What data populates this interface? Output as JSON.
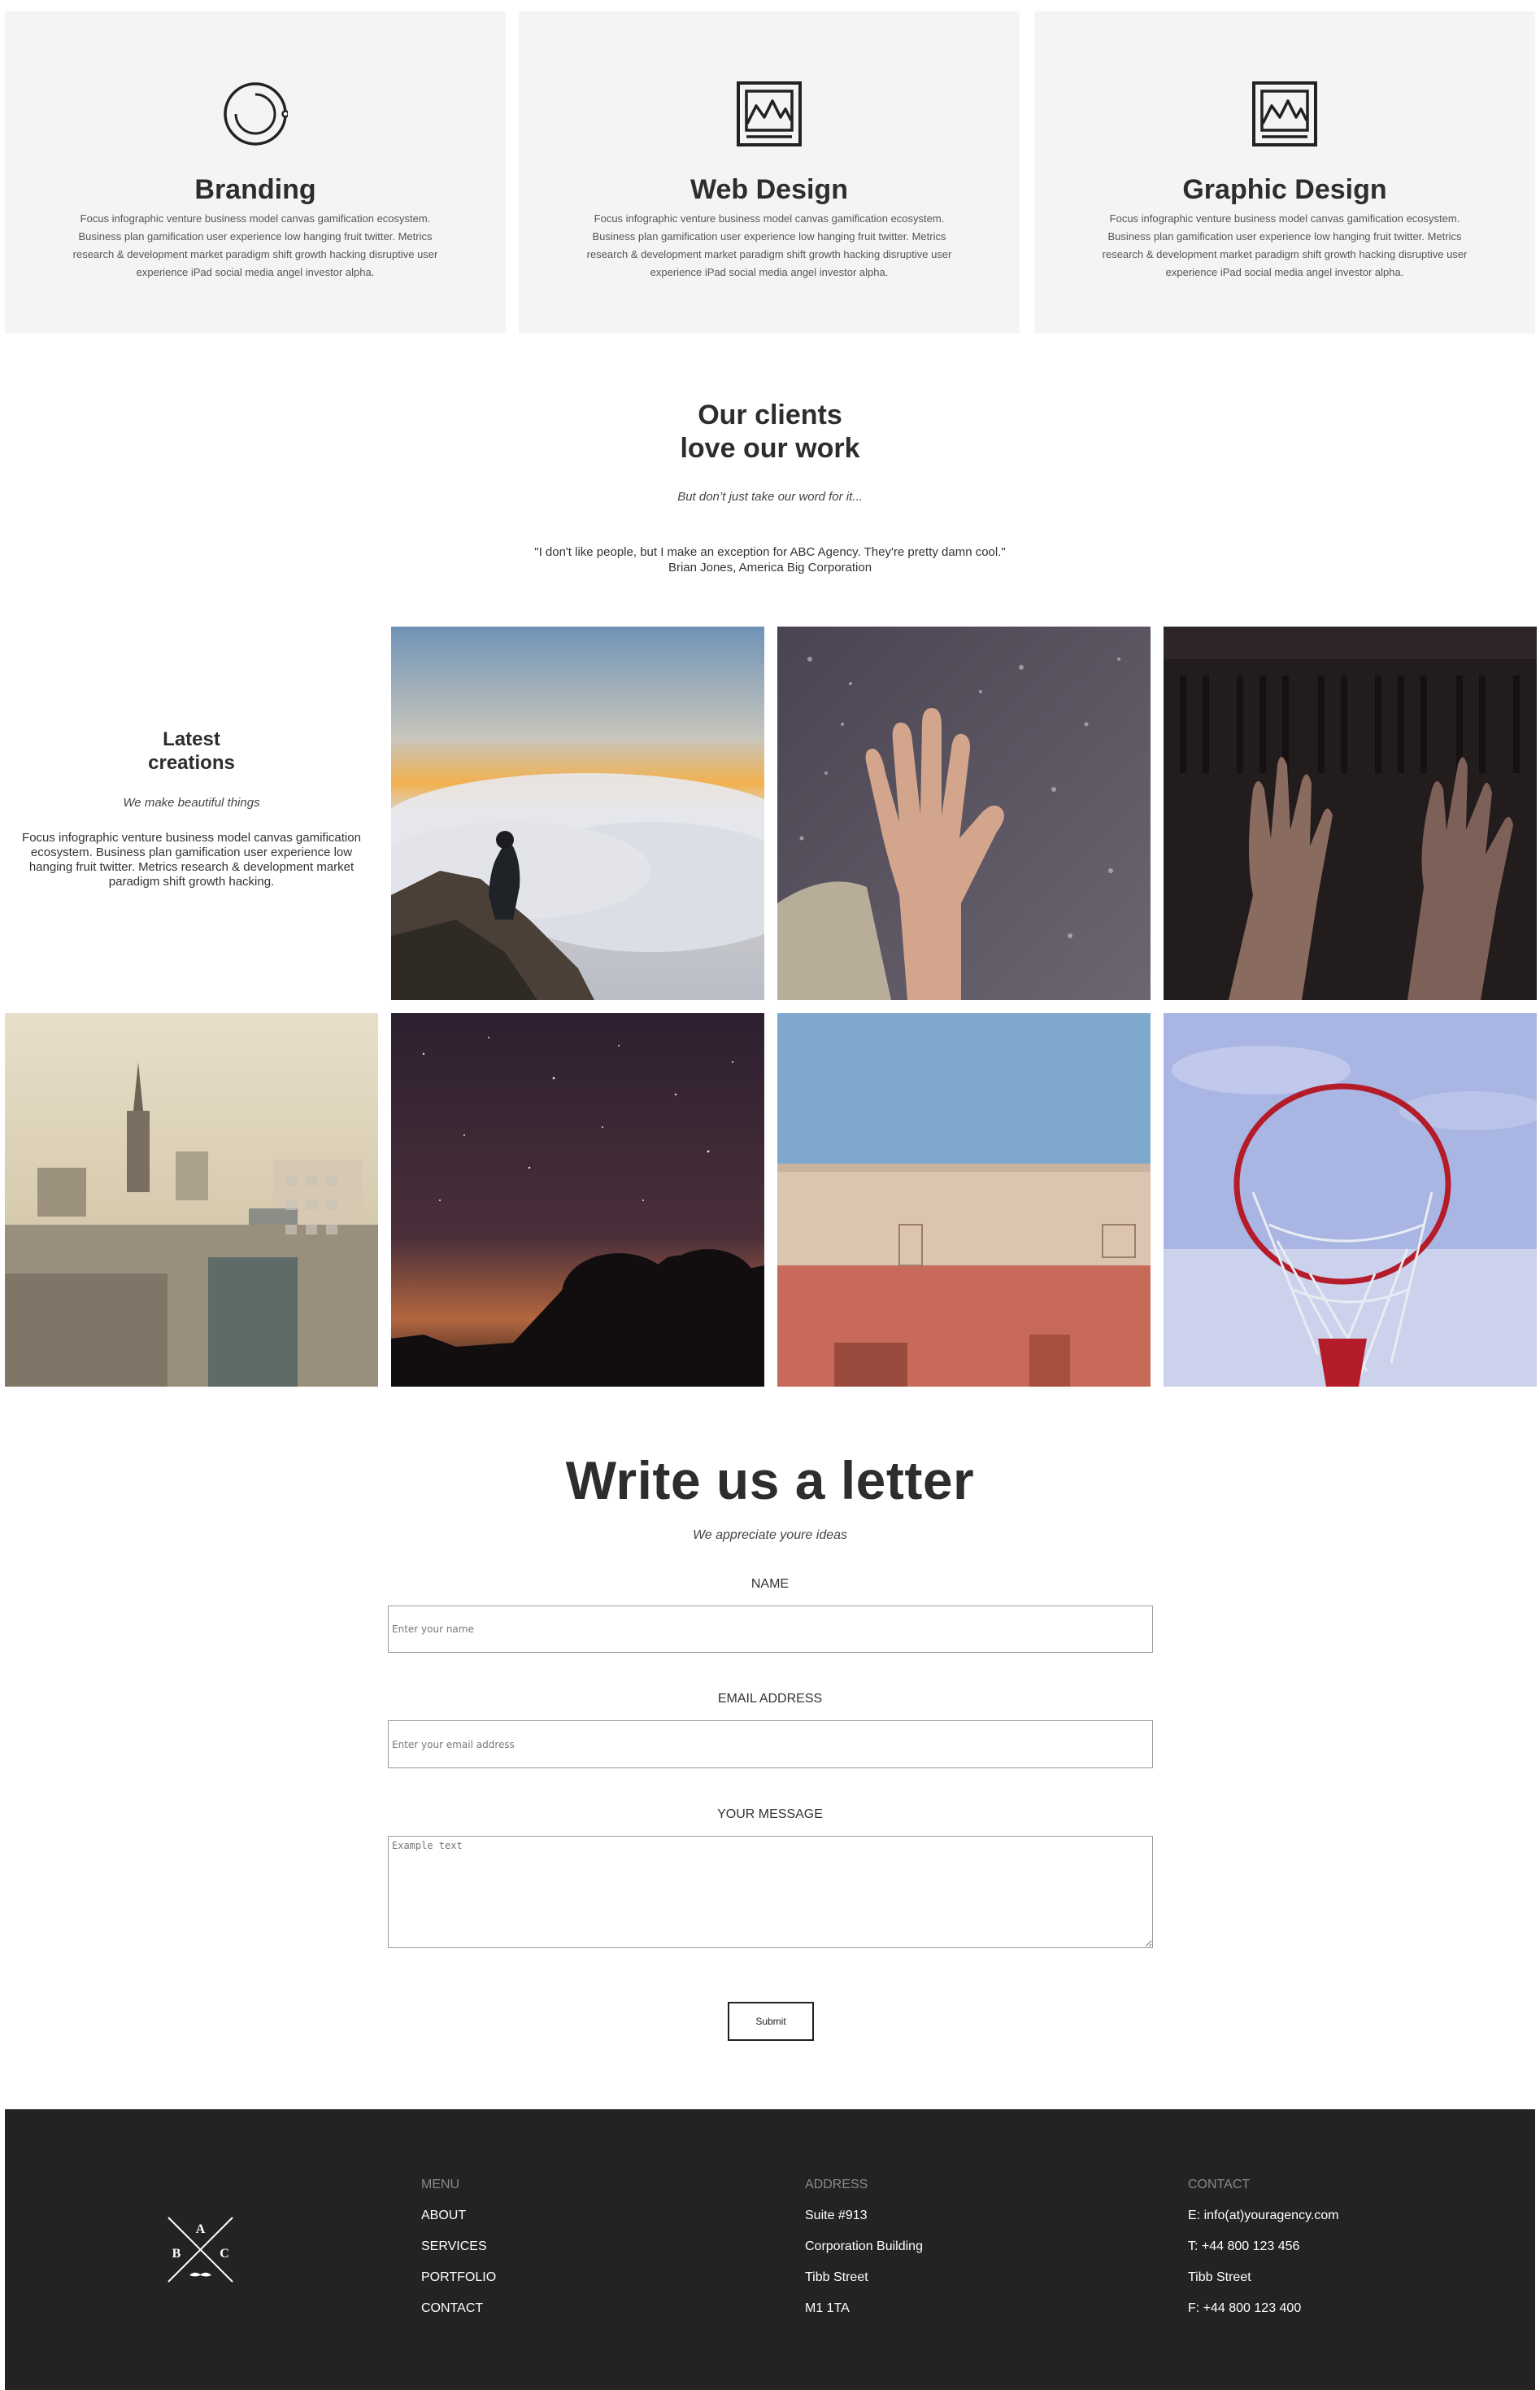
{
  "services": [
    {
      "icon": "circle-loader-icon",
      "title": "Branding",
      "text": "Focus infographic venture business model canvas gamification ecosystem. Business plan gamification user experience low hanging fruit twitter. Metrics research & development market paradigm shift growth hacking disruptive user experience iPad social media angel investor alpha."
    },
    {
      "icon": "image-frame-icon",
      "title": "Web Design",
      "text": "Focus infographic venture business model canvas gamification ecosystem. Business plan gamification user experience low hanging fruit twitter. Metrics research & development market paradigm shift growth hacking disruptive user experience iPad social media angel investor alpha."
    },
    {
      "icon": "image-frame-icon",
      "title": "Graphic Design",
      "text": "Focus infographic venture business model canvas gamification ecosystem. Business plan gamification user experience low hanging fruit twitter. Metrics research & development market paradigm shift growth hacking disruptive user experience iPad social media angel investor alpha."
    }
  ],
  "testimonials": {
    "title_line1": "Our clients",
    "title_line2": "love our work",
    "subtitle": "But don’t just take our word for it...",
    "quote": "\"I don't like people, but I make an exception for ABC Agency. They're pretty damn cool.\"",
    "author": "Brian Jones, America Big Corporation"
  },
  "gallery": {
    "title_line1": "Latest",
    "title_line2": "creations",
    "subtitle": "We make beautiful things",
    "text": "Focus infographic venture business model canvas gamification ecosystem. Business plan gamification user experience low hanging fruit twitter. Metrics research & development market paradigm shift growth hacking.",
    "images": [
      "person-above-clouds-photo",
      "hand-on-rainy-window-photo",
      "hands-on-piano-photo",
      "city-skyline-photo",
      "starry-night-trees-photo",
      "building-wall-sky-photo",
      "basketball-hoop-photo"
    ]
  },
  "contact": {
    "title": "Write us a letter",
    "subtitle": "We appreciate youre ideas",
    "name_label": "NAME",
    "name_placeholder": "Enter your name",
    "email_label": "EMAIL ADDRESS",
    "email_placeholder": "Enter your email address",
    "message_label": "YOUR MESSAGE",
    "message_placeholder": "Example text",
    "submit_label": "Submit"
  },
  "footer": {
    "logo_letters": [
      "A",
      "B",
      "C"
    ],
    "menu": {
      "heading": "MENU",
      "items": [
        "ABOUT",
        "SERVICES",
        "PORTFOLIO",
        "CONTACT"
      ]
    },
    "address": {
      "heading": "ADDRESS",
      "lines": [
        "Suite #913",
        "Corporation Building",
        "Tibb Street",
        "M1 1TA"
      ]
    },
    "contact": {
      "heading": "CONTACT",
      "lines": [
        "E: info(at)youragency.com",
        "T: +44 800 123 456",
        "Tibb Street",
        "F: +44 800 123 400"
      ]
    }
  },
  "colors": {
    "card_bg": "#f4f4f4",
    "footer_bg": "#232323",
    "text_dark": "#2d2d2d"
  }
}
